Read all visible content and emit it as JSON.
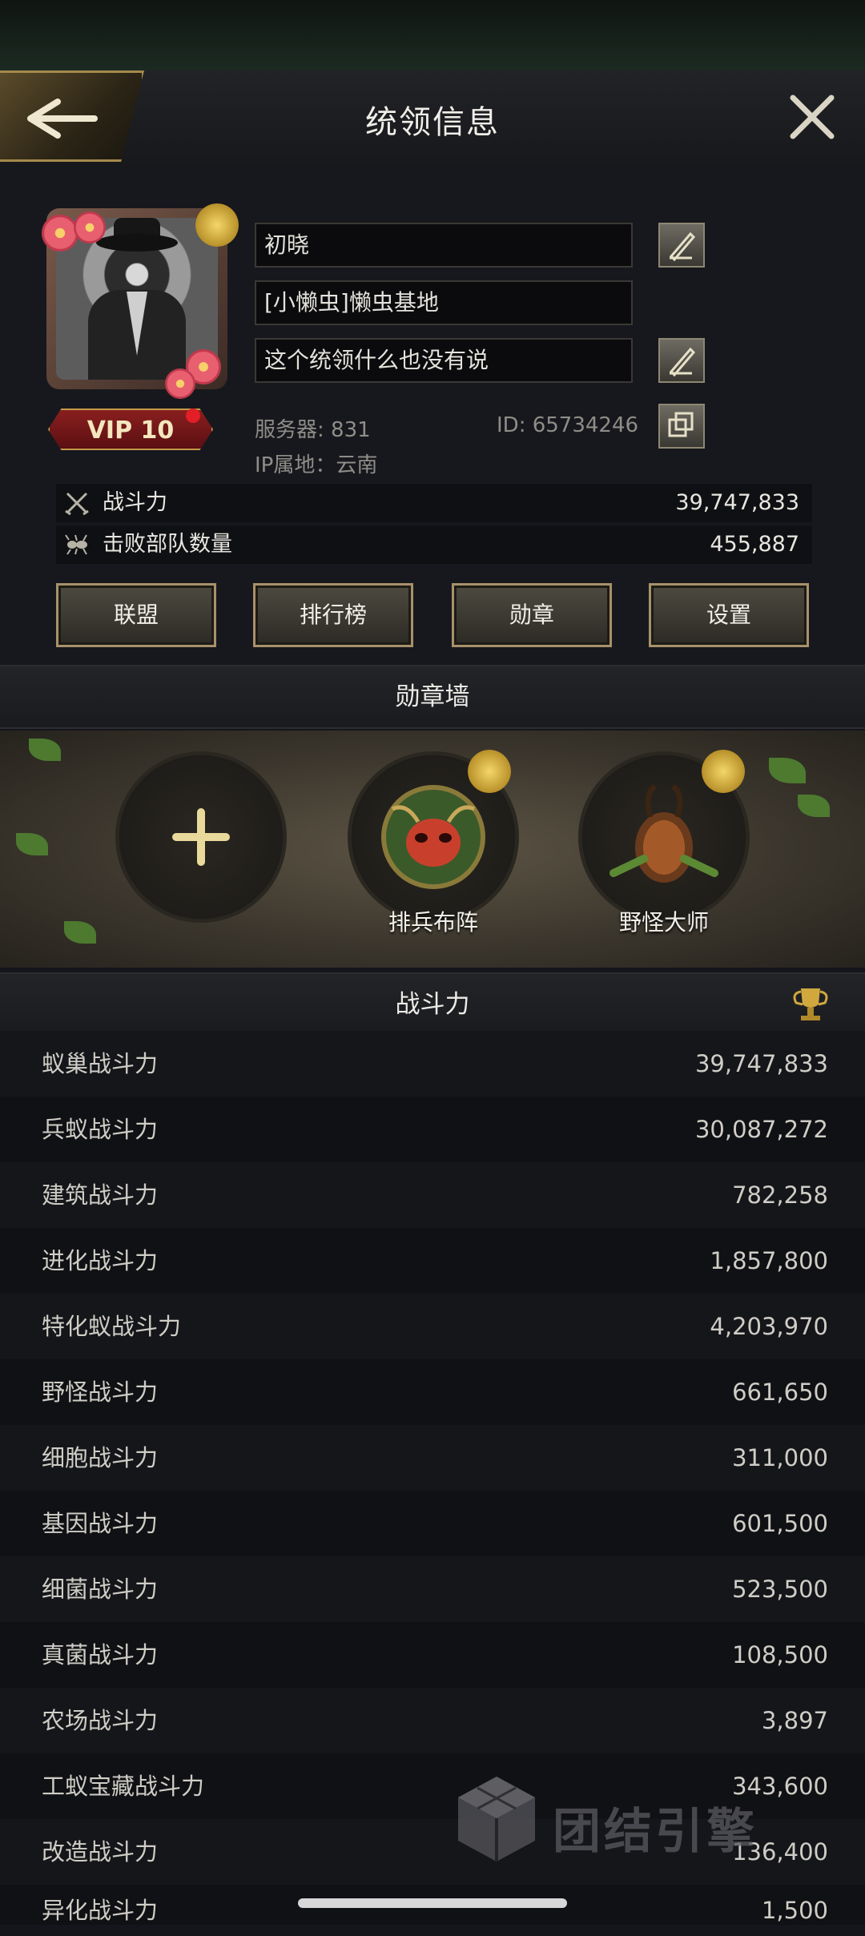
{
  "header": {
    "title": "统领信息"
  },
  "profile": {
    "name": "初晓",
    "alliance": "[小懒虫]懒虫基地",
    "signature": "这个统领什么也没有说",
    "vip": "VIP 10",
    "server": "服务器: 831",
    "player_id": "ID: 65734246",
    "ip_location": "IP属地：云南"
  },
  "stats": [
    {
      "label": "战斗力",
      "value": "39,747,833",
      "icon": "crossed-swords-icon"
    },
    {
      "label": "击败部队数量",
      "value": "455,887",
      "icon": "ant-icon"
    }
  ],
  "buttons": {
    "alliance": "联盟",
    "ranking": "排行榜",
    "medal": "勋章",
    "settings": "设置"
  },
  "medal_wall": {
    "title": "勋章墙",
    "slots": [
      {
        "label": "",
        "icon": "plus-icon"
      },
      {
        "label": "排兵布阵",
        "icon": "ant-head-medal-icon"
      },
      {
        "label": "野怪大师",
        "icon": "beetle-medal-icon"
      }
    ]
  },
  "power": {
    "title": "战斗力",
    "rows": [
      {
        "name": "蚁巢战斗力",
        "value": "39,747,833"
      },
      {
        "name": "兵蚁战斗力",
        "value": "30,087,272"
      },
      {
        "name": "建筑战斗力",
        "value": "782,258"
      },
      {
        "name": "进化战斗力",
        "value": "1,857,800"
      },
      {
        "name": "特化蚁战斗力",
        "value": "4,203,970"
      },
      {
        "name": "野怪战斗力",
        "value": "661,650"
      },
      {
        "name": "细胞战斗力",
        "value": "311,000"
      },
      {
        "name": "基因战斗力",
        "value": "601,500"
      },
      {
        "name": "细菌战斗力",
        "value": "523,500"
      },
      {
        "name": "真菌战斗力",
        "value": "108,500"
      },
      {
        "name": "农场战斗力",
        "value": "3,897"
      },
      {
        "name": "工蚁宝藏战斗力",
        "value": "343,600"
      },
      {
        "name": "改造战斗力",
        "value": "136,400"
      },
      {
        "name": "异化战斗力",
        "value": "1,500"
      }
    ]
  },
  "watermark": {
    "text": "团结引擎"
  }
}
